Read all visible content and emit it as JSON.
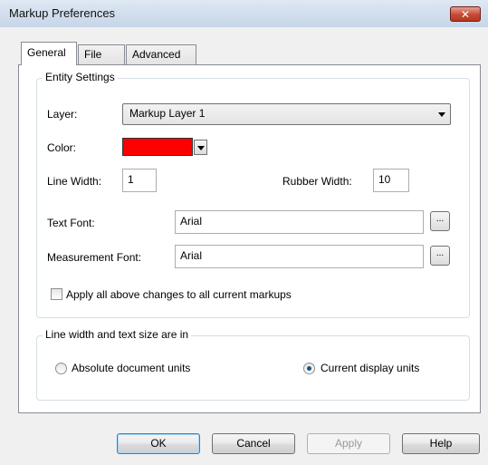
{
  "window": {
    "title": "Markup Preferences",
    "close_glyph": "✕"
  },
  "tabs": [
    {
      "label": "General",
      "active": true
    },
    {
      "label": "File",
      "active": false
    },
    {
      "label": "Advanced",
      "active": false
    }
  ],
  "entity_settings": {
    "group_label": "Entity Settings",
    "layer_label": "Layer:",
    "layer_value": "Markup Layer 1",
    "color_label": "Color:",
    "color_value": "#ff0000",
    "line_width_label": "Line Width:",
    "line_width_value": "1",
    "rubber_width_label": "Rubber Width:",
    "rubber_width_value": "10",
    "text_font_label": "Text Font:",
    "text_font_value": "Arial",
    "measurement_font_label": "Measurement Font:",
    "measurement_font_value": "Arial",
    "browse_label": "...",
    "apply_all_label": "Apply all above changes to all current markups",
    "apply_all_checked": false
  },
  "units": {
    "group_label": "Line width and text size are in",
    "absolute_label": "Absolute document units",
    "current_label": "Current display units",
    "selected": "current"
  },
  "buttons": {
    "ok": "OK",
    "cancel": "Cancel",
    "apply": "Apply",
    "help": "Help"
  }
}
